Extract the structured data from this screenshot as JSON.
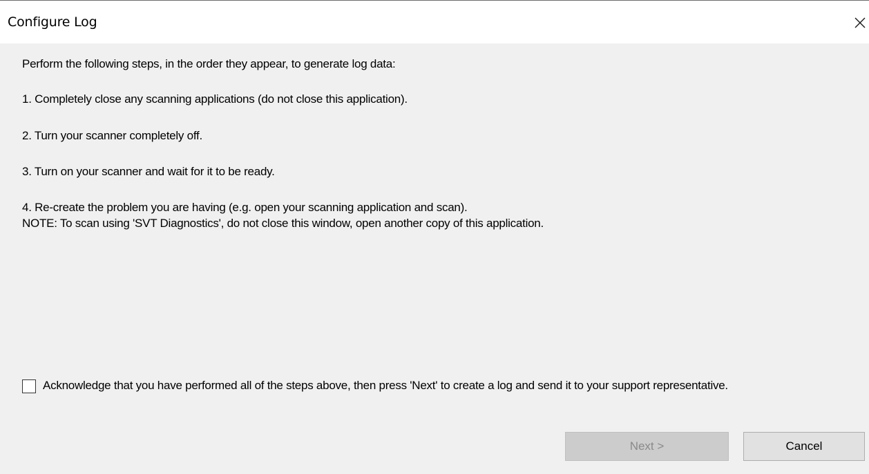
{
  "window": {
    "title": "Configure Log"
  },
  "instructions": {
    "intro": "Perform the following steps, in the order they appear, to generate log data:",
    "step1": "1. Completely close any scanning applications (do not close this application).",
    "step2": "2. Turn your scanner completely off.",
    "step3": "3. Turn on your scanner and wait for it to be ready.",
    "step4": "4. Re-create the problem you are having (e.g. open your scanning application and scan).",
    "note": "NOTE: To scan using 'SVT Diagnostics', do not close this window, open another copy of this application."
  },
  "acknowledge": {
    "label": "Acknowledge that you have performed all of the steps above, then press 'Next' to create a log and send it to your support representative.",
    "checked": false
  },
  "buttons": {
    "next_label": "Next >",
    "next_enabled": false,
    "cancel_label": "Cancel"
  },
  "colors": {
    "dialog_background": "#f0f0f0",
    "titlebar_background": "#ffffff",
    "disabled_button": "#cccccc",
    "disabled_text": "#8a8a8a",
    "button_face": "#e1e1e1"
  },
  "icons": {
    "close": "close-icon"
  }
}
